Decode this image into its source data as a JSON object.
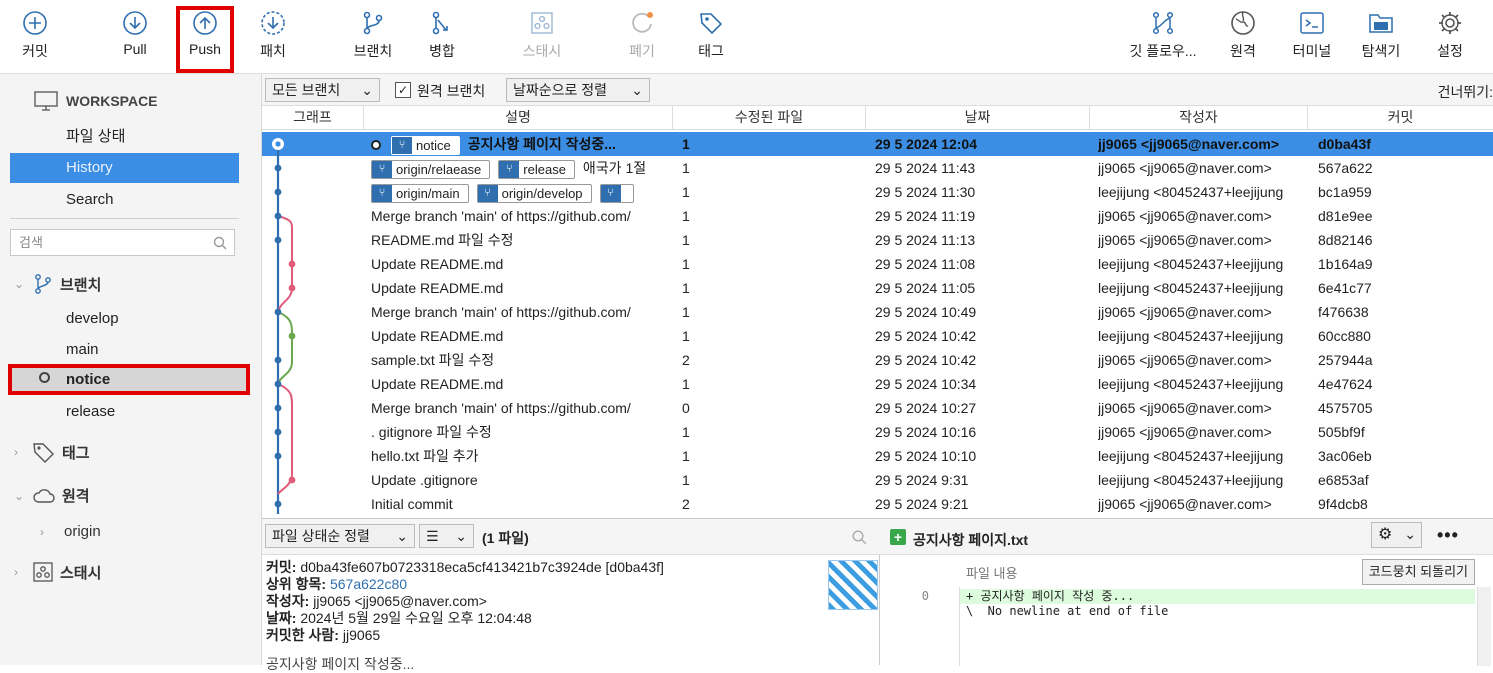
{
  "toolbar": {
    "commit": "커밋",
    "pull": "Pull",
    "push": "Push",
    "patch": "패치",
    "branch": "브랜치",
    "merge": "병합",
    "stash": "스태시",
    "discard": "폐기",
    "tag": "태그",
    "gitflow": "깃 플로우...",
    "remote": "원격",
    "terminal": "터미널",
    "explorer": "탐색기",
    "settings": "설정"
  },
  "sidebar": {
    "workspace": "WORKSPACE",
    "file_status": "파일 상태",
    "history": "History",
    "search": "Search",
    "search_placeholder": "검색",
    "branches_label": "브랜치",
    "branches": [
      "develop",
      "main",
      "notice",
      "release"
    ],
    "tags_label": "태그",
    "remotes_label": "원격",
    "remote_origin": "origin",
    "stash_label": "스태시"
  },
  "history_bar": {
    "all_branches": "모든 브랜치",
    "remote_branches": "원격 브랜치",
    "sort": "날짜순으로 정렬",
    "skip": "건너뛰기:"
  },
  "columns": {
    "graph": "그래프",
    "description": "설명",
    "files": "수정된 파일",
    "date": "날짜",
    "author": "작성자",
    "commit": "커밋"
  },
  "labels": {
    "notice": "notice",
    "origin_relaease": "origin/relaease",
    "release": "release",
    "origin_main": "origin/main",
    "origin_develop": "origin/develop"
  },
  "commits": [
    {
      "msg": "공지사항 페이지 작성중...",
      "files": "1",
      "date": "29 5 2024 12:04",
      "author": "jj9065 <jj9065@naver.com>",
      "hash": "d0ba43f"
    },
    {
      "msg": "애국가 1절",
      "files": "1",
      "date": "29 5 2024 11:43",
      "author": "jj9065 <jj9065@naver.com>",
      "hash": "567a622"
    },
    {
      "msg": "",
      "files": "1",
      "date": "29 5 2024 11:30",
      "author": "leejijung <80452437+leejijung",
      "hash": "bc1a959"
    },
    {
      "msg": "Merge branch 'main' of https://github.com/",
      "files": "1",
      "date": "29 5 2024 11:19",
      "author": "jj9065 <jj9065@naver.com>",
      "hash": "d81e9ee"
    },
    {
      "msg": "README.md 파일 수정",
      "files": "1",
      "date": "29 5 2024 11:13",
      "author": "jj9065 <jj9065@naver.com>",
      "hash": "8d82146"
    },
    {
      "msg": "Update README.md",
      "files": "1",
      "date": "29 5 2024 11:08",
      "author": "leejijung <80452437+leejijung",
      "hash": "1b164a9"
    },
    {
      "msg": "Update README.md",
      "files": "1",
      "date": "29 5 2024 11:05",
      "author": "leejijung <80452437+leejijung",
      "hash": "6e41c77"
    },
    {
      "msg": "Merge branch 'main' of https://github.com/",
      "files": "1",
      "date": "29 5 2024 10:49",
      "author": "jj9065 <jj9065@naver.com>",
      "hash": "f476638"
    },
    {
      "msg": "Update README.md",
      "files": "1",
      "date": "29 5 2024 10:42",
      "author": "leejijung <80452437+leejijung",
      "hash": "60cc880"
    },
    {
      "msg": "sample.txt 파일 수정",
      "files": "2",
      "date": "29 5 2024 10:42",
      "author": "jj9065 <jj9065@naver.com>",
      "hash": "257944a"
    },
    {
      "msg": "Update README.md",
      "files": "1",
      "date": "29 5 2024 10:34",
      "author": "leejijung <80452437+leejijung",
      "hash": "4e47624"
    },
    {
      "msg": "Merge branch 'main' of https://github.com/",
      "files": "0",
      "date": "29 5 2024 10:27",
      "author": "jj9065 <jj9065@naver.com>",
      "hash": "4575705"
    },
    {
      "msg": ". gitignore 파일 수정",
      "files": "1",
      "date": "29 5 2024 10:16",
      "author": "jj9065 <jj9065@naver.com>",
      "hash": "505bf9f"
    },
    {
      "msg": "hello.txt 파일 추가",
      "files": "1",
      "date": "29 5 2024 10:10",
      "author": "leejijung <80452437+leejijung",
      "hash": "3ac06eb"
    },
    {
      "msg": "Update .gitignore",
      "files": "1",
      "date": "29 5 2024 9:31",
      "author": "leejijung <80452437+leejijung",
      "hash": "e6853af"
    },
    {
      "msg": "Initial commit",
      "files": "2",
      "date": "29 5 2024 9:21",
      "author": "jj9065 <jj9065@naver.com>",
      "hash": "9f4dcb8"
    }
  ],
  "details": {
    "sort": "파일 상태순 정렬",
    "file_count": "(1 파일)",
    "commit_label": "커밋:",
    "commit_value": "d0ba43fe607b0723318eca5cf413421b7c3924de [d0ba43f]",
    "parent_label": "상위 항목:",
    "parent_value": "567a622c80",
    "author_label": "작성자:",
    "author_value": "jj9065 <jj9065@naver.com>",
    "date_label": "날짜:",
    "date_value": "2024년 5월 29일 수요일 오후 12:04:48",
    "committer_label": "커밋한 사람:",
    "committer_value": "jj9065",
    "message_preview": "공지사항 페이지 작성중..."
  },
  "diff": {
    "filename": "공지사항 페이지.txt",
    "file_content": "파일 내용",
    "revert_hunk": "코드뭉치 되돌리기",
    "line_no": "0",
    "line1": "+ 공지사항 페이지 작성 중...",
    "line2": "\\  No newline at end of file"
  },
  "colors": {
    "accent": "#3b8ee3",
    "highlight": "#e00000",
    "graph_blue": "#2f6fb0",
    "graph_pink": "#e05a7a",
    "graph_green": "#6aa84f"
  }
}
